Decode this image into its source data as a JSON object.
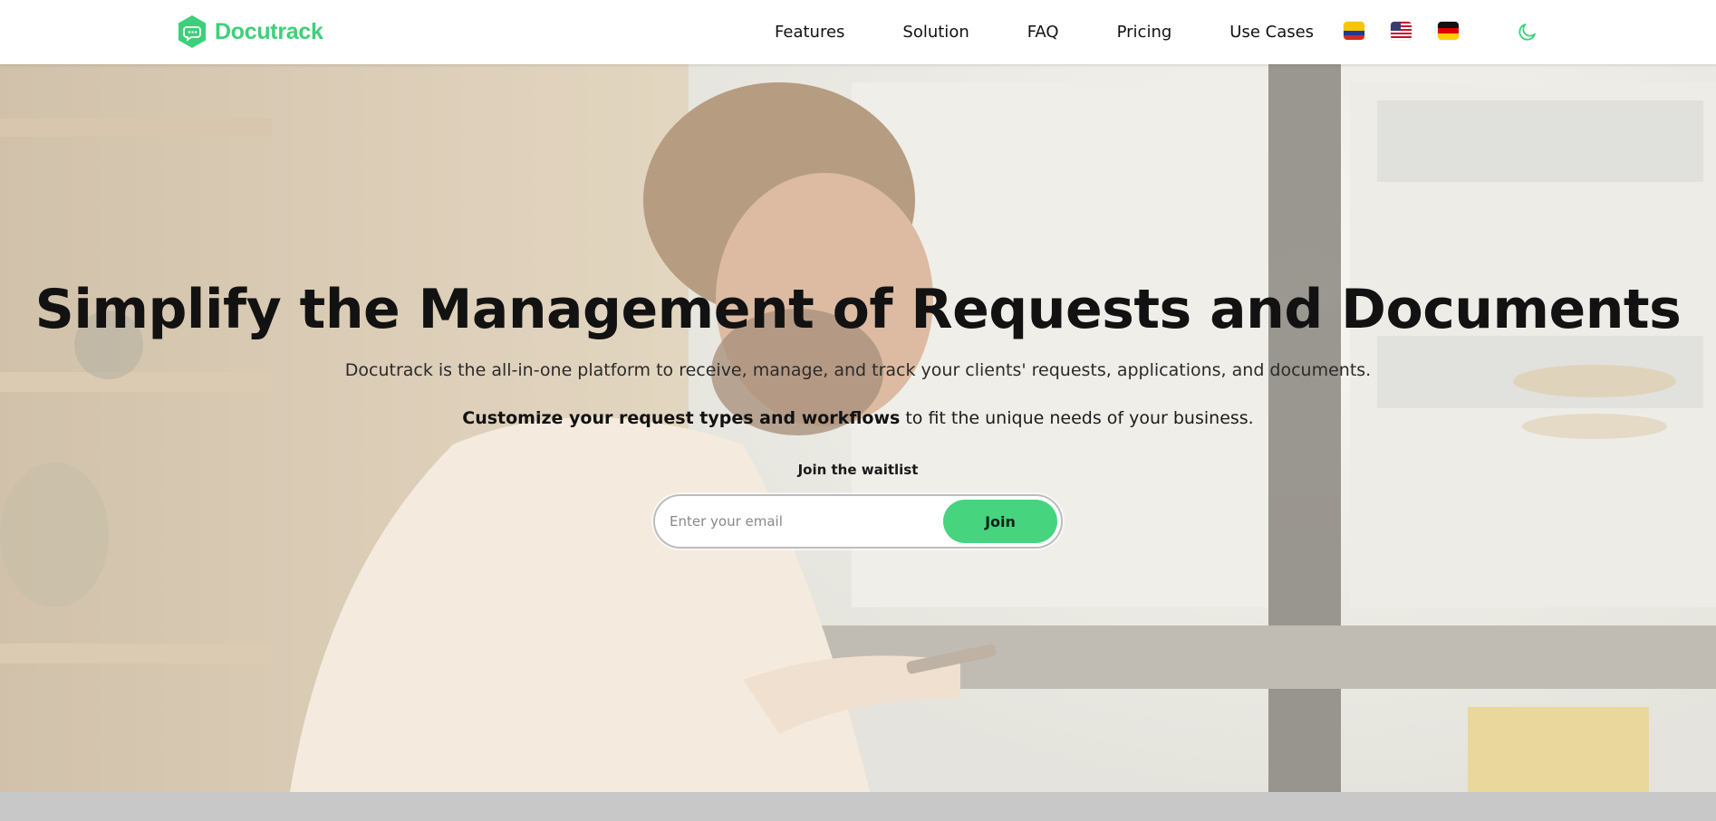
{
  "brand": {
    "name": "Docutrack",
    "color": "#3ecf7a"
  },
  "nav": {
    "links": [
      "Features",
      "Solution",
      "FAQ",
      "Pricing",
      "Use Cases"
    ],
    "flags": [
      "colombia-flag",
      "usa-flag",
      "germany-flag"
    ],
    "theme_icon": "moon-icon"
  },
  "hero": {
    "title": "Simplify the Management of Requests and Documents",
    "subtitle": "Docutrack is the all-in-one platform to receive, manage, and track your clients' requests, applications, and documents.",
    "subtitle2_bold": "Customize your request types and workflows",
    "subtitle2_rest": " to fit the unique needs of your business.",
    "waitlist_label": "Join the waitlist",
    "email_placeholder": "Enter your email",
    "join_label": "Join",
    "accent": "#46d47f"
  }
}
